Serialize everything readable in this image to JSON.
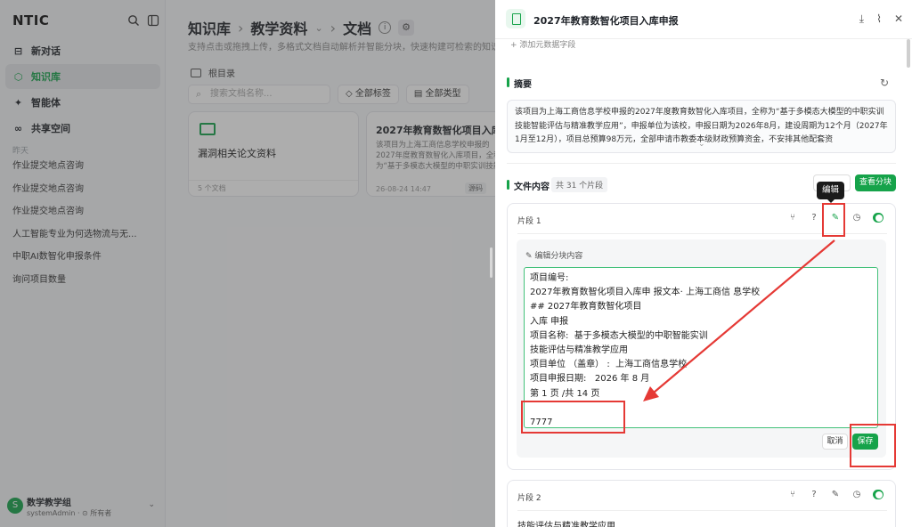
{
  "sidebar": {
    "logo": "NTIC",
    "nav": [
      {
        "label": "新对话",
        "icon": "chat-icon",
        "glyph": "⊟"
      },
      {
        "label": "知识库",
        "icon": "knowledge-base-icon",
        "glyph": "⬡"
      },
      {
        "label": "智能体",
        "icon": "agent-icon",
        "glyph": "✦"
      },
      {
        "label": "共享空间",
        "icon": "share-space-icon",
        "glyph": "∞"
      }
    ],
    "recent_title": "昨天",
    "recent": [
      "作业提交地点咨询",
      "作业提交地点咨询",
      "作业提交地点咨询",
      "人工智能专业为何选物流与无...",
      "中职AI数智化申报条件",
      "询问项目数量"
    ],
    "user": {
      "avatar": "S",
      "name": "数学教学组",
      "role": "systemAdmin · ⊙ 所有者"
    }
  },
  "main": {
    "breadcrumb": [
      "知识库",
      "教学资料",
      "文档"
    ],
    "subtitle": "支持点击或拖拽上传，多格式文档自动解析并智能分块，快速构建可检索的知识",
    "root": "根目录",
    "search_placeholder": "搜索文档名称...",
    "tag_filter": "◇ 全部标签",
    "type_filter": "▤ 全部类型",
    "card1": {
      "title": "漏洞相关论文资料",
      "footer": "5 个文档"
    },
    "card2": {
      "title": "2027年教育数智化项目入库申",
      "desc": "该项目为上海工商信息学校申报的2027年度教育数智化入库项目，全称为“基于多模态大模型的中职实训技能智能评估与精准教学应用”",
      "date": "26-08-24 14:47",
      "tag": "源码"
    }
  },
  "panel": {
    "title": "2027年教育数智化项目入库申报",
    "add_meta": "+ 添加元数据字段",
    "summary_title": "摘要",
    "summary": "该项目为上海工商信息学校申报的2027年度教育数智化入库项目，全称为“基于多模态大模型的中职实训技能智能评估与精准教学应用”，申报单位为该校，申报日期为2026年8月，建设周期为12个月（2027年1月至12月），项目总预算98万元，全部申请市教委本级财政预算资金，不安排其他配套资",
    "content_title": "文件内容",
    "segment_count": "共 31 个片段",
    "view_chunks": "查看分块",
    "tooltip": "编辑",
    "segment1": {
      "label": "片段 1",
      "edit_label": "编辑分块内容",
      "text": "项目编号:\n2027年教育数智化项目入库申 报文本· 上海工商信 息学校\n## 2027年教育数智化项目\n入库 申报\n项目名称:  基于多模态大模型的中职智能实训\n技能评估与精准教学应用\n项目单位 （盖章） :  上海工商信息学校\n项目申报日期:   2026 年 8 月\n第 1 页 /共 14 页\n\n7777",
      "cancel": "取消",
      "save": "保存"
    },
    "segment2": {
      "label": "片段 2",
      "text": "技能评估与精准教学应用"
    }
  },
  "colors": {
    "accent": "#16a34a",
    "annotation": "#e53935"
  }
}
